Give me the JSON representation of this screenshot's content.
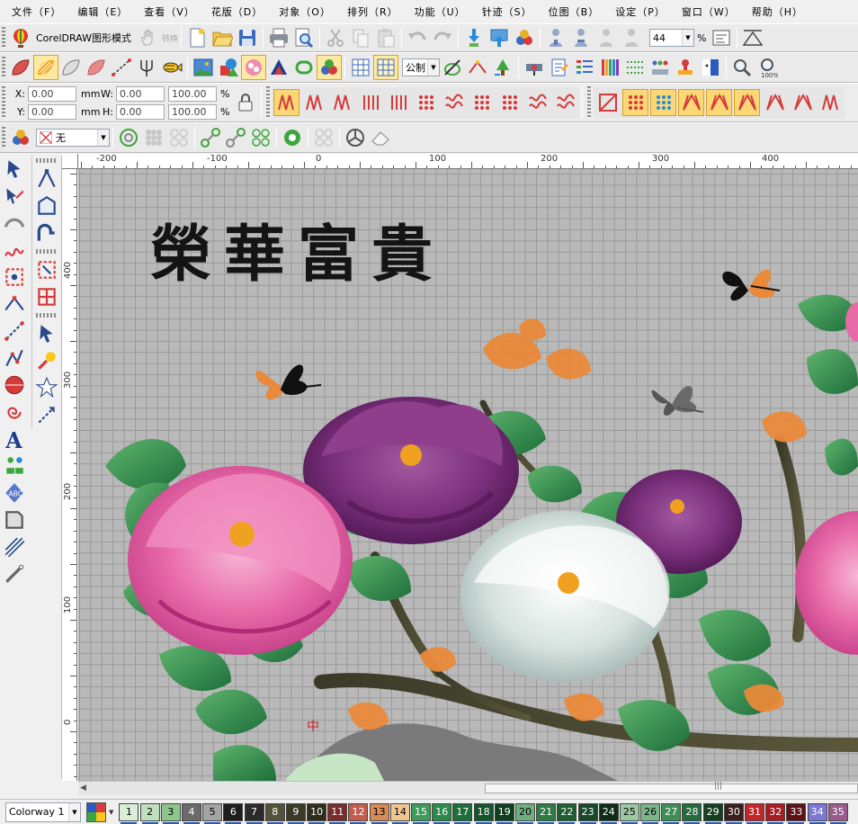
{
  "menubar": {
    "items": [
      {
        "label": "文件（F）"
      },
      {
        "label": "编辑（E）"
      },
      {
        "label": "查看（V）"
      },
      {
        "label": "花版（D）"
      },
      {
        "label": "对象（O）"
      },
      {
        "label": "排列（R）"
      },
      {
        "label": "功能（U）"
      },
      {
        "label": "针迹（S）"
      },
      {
        "label": "位图（B）"
      },
      {
        "label": "设定（P）"
      },
      {
        "label": "窗口（W）"
      },
      {
        "label": "帮助（H）"
      }
    ]
  },
  "toolbar_main": {
    "mode_label": "CorelDRAW图形模式",
    "disabled_label": "转换",
    "zoom_value": "44",
    "zoom_unit": "%"
  },
  "toolbar_edit": {
    "unit_combo": "公制"
  },
  "property_bar": {
    "x_label": "X:",
    "x_value": "0.00",
    "y_label": "Y:",
    "y_value": "0.00",
    "w_label": "W:",
    "w_value": "0.00",
    "h_label": "H:",
    "h_value": "0.00",
    "unit": "mm",
    "scale_x": "100.00",
    "scale_y": "100.00",
    "pct": "%"
  },
  "toolbar_color": {
    "outline_combo": "无"
  },
  "rulers": {
    "horizontal": [
      "-200",
      "-100",
      "0",
      "100",
      "200",
      "300",
      "400"
    ],
    "vertical": [
      "400",
      "300",
      "200",
      "100",
      "0"
    ]
  },
  "design": {
    "title_text": "榮華富貴",
    "small_mark": "中"
  },
  "palette": {
    "colorway": "Colorway 1",
    "chips": [
      {
        "n": "1",
        "c": "#d9efd9"
      },
      {
        "n": "2",
        "c": "#bfe0bf"
      },
      {
        "n": "3",
        "c": "#8cc68c"
      },
      {
        "n": "4",
        "c": "#6a6a6a"
      },
      {
        "n": "5",
        "c": "#a4a4a4"
      },
      {
        "n": "6",
        "c": "#1e1e1e"
      },
      {
        "n": "7",
        "c": "#2b2b2b"
      },
      {
        "n": "8",
        "c": "#53533a"
      },
      {
        "n": "9",
        "c": "#3a3a26"
      },
      {
        "n": "10",
        "c": "#2e2e1d"
      },
      {
        "n": "11",
        "c": "#7a2d2d"
      },
      {
        "n": "12",
        "c": "#c35c4c"
      },
      {
        "n": "13",
        "c": "#d88a57"
      },
      {
        "n": "14",
        "c": "#f0c690"
      },
      {
        "n": "15",
        "c": "#3e9c5a"
      },
      {
        "n": "16",
        "c": "#2a8a4a"
      },
      {
        "n": "17",
        "c": "#1d6e3a"
      },
      {
        "n": "18",
        "c": "#15552c"
      },
      {
        "n": "19",
        "c": "#0f3e20"
      },
      {
        "n": "20",
        "c": "#6fae7e"
      },
      {
        "n": "21",
        "c": "#2f7b46"
      },
      {
        "n": "22",
        "c": "#1f5e34"
      },
      {
        "n": "23",
        "c": "#17482a"
      },
      {
        "n": "24",
        "c": "#0d2d18"
      },
      {
        "n": "25",
        "c": "#9cc8a4"
      },
      {
        "n": "26",
        "c": "#7bb58a"
      },
      {
        "n": "27",
        "c": "#3d8f55"
      },
      {
        "n": "28",
        "c": "#236b3b"
      },
      {
        "n": "29",
        "c": "#143f22"
      },
      {
        "n": "30",
        "c": "#3b1f1f"
      },
      {
        "n": "31",
        "c": "#c0262a"
      },
      {
        "n": "32",
        "c": "#a81d23"
      },
      {
        "n": "33",
        "c": "#5a1418"
      },
      {
        "n": "34",
        "c": "#7d77d6"
      },
      {
        "n": "35",
        "c": "#9a5a8c"
      }
    ]
  },
  "colors": {
    "accent_hl": "#fbd776",
    "grid_bg": "#b9b9b9",
    "grid_line": "#9a9a9a"
  }
}
